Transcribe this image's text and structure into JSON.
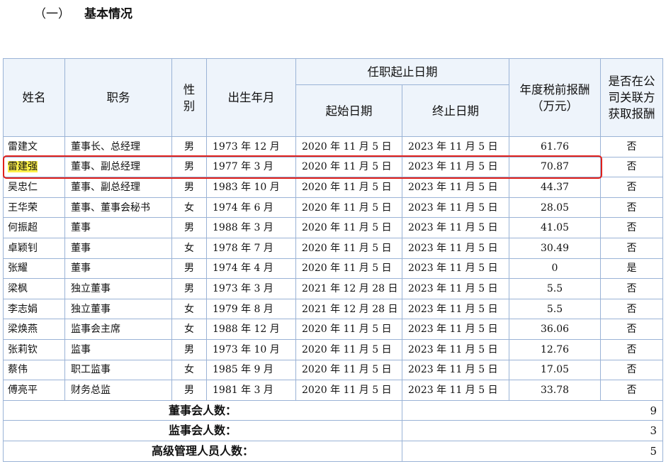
{
  "section": {
    "number": "（一）",
    "title": "基本情况"
  },
  "table": {
    "headers": {
      "name": "姓名",
      "position": "职务",
      "gender": "性别",
      "birth": "出生年月",
      "term": "任职起止日期",
      "start": "起始日期",
      "end": "终止日期",
      "salary": "年度税前报酬（万元）",
      "related": "是否在公司关联方获取报酬"
    },
    "rows": [
      {
        "name": "雷建文",
        "position": "董事长、总经理",
        "gender": "男",
        "birth": "1973 年 12 月",
        "start": "2020 年 11 月 5 日",
        "end": "2023 年 11 月 5 日",
        "salary": "61.76",
        "related": "否"
      },
      {
        "name": "雷建强",
        "position": "董事、副总经理",
        "gender": "男",
        "birth": "1977 年 3 月",
        "start": "2020 年 11 月 5 日",
        "end": "2023 年 11 月 5 日",
        "salary": "70.87",
        "related": "否"
      },
      {
        "name": "吴忠仁",
        "position": "董事、副总经理",
        "gender": "男",
        "birth": "1983 年 10 月",
        "start": "2020 年 11 月 5 日",
        "end": "2023 年 11 月 5 日",
        "salary": "44.37",
        "related": "否"
      },
      {
        "name": "王华荣",
        "position": "董事、董事会秘书",
        "gender": "女",
        "birth": "1974 年 6 月",
        "start": "2020 年 11 月 5 日",
        "end": "2023 年 11 月 5 日",
        "salary": "28.05",
        "related": "否"
      },
      {
        "name": "何振超",
        "position": "董事",
        "gender": "男",
        "birth": "1988 年 3 月",
        "start": "2020 年 11 月 5 日",
        "end": "2023 年 11 月 5 日",
        "salary": "41.05",
        "related": "否"
      },
      {
        "name": "卓颖钊",
        "position": "董事",
        "gender": "女",
        "birth": "1978 年 7 月",
        "start": "2020 年 11 月 5 日",
        "end": "2023 年 11 月 5 日",
        "salary": "30.49",
        "related": "否"
      },
      {
        "name": "张耀",
        "position": "董事",
        "gender": "男",
        "birth": "1974 年 4 月",
        "start": "2020 年 11 月 5 日",
        "end": "2023 年 11 月 5 日",
        "salary": "0",
        "related": "是"
      },
      {
        "name": "梁枫",
        "position": "独立董事",
        "gender": "男",
        "birth": "1973 年 3 月",
        "start": "2021 年 12 月 28 日",
        "end": "2023 年 11 月 5 日",
        "salary": "5.5",
        "related": "否"
      },
      {
        "name": "李志娟",
        "position": "独立董事",
        "gender": "女",
        "birth": "1979 年 8 月",
        "start": "2021 年 12 月 28 日",
        "end": "2023 年 11 月 5 日",
        "salary": "5.5",
        "related": "否"
      },
      {
        "name": "梁焕燕",
        "position": "监事会主席",
        "gender": "女",
        "birth": "1988 年 12 月",
        "start": "2020 年 11 月 5 日",
        "end": "2023 年 11 月 5 日",
        "salary": "36.06",
        "related": "否"
      },
      {
        "name": "张莉钦",
        "position": "监事",
        "gender": "男",
        "birth": "1973 年 10 月",
        "start": "2020 年 11 月 5 日",
        "end": "2023 年 11 月 5 日",
        "salary": "12.76",
        "related": "否"
      },
      {
        "name": "蔡伟",
        "position": "职工监事",
        "gender": "女",
        "birth": "1985 年 9 月",
        "start": "2020 年 11 月 5 日",
        "end": "2023 年 11 月 5 日",
        "salary": "17.05",
        "related": "否"
      },
      {
        "name": "傅亮平",
        "position": "财务总监",
        "gender": "男",
        "birth": "1981 年 3 月",
        "start": "2020 年 11 月 5 日",
        "end": "2023 年 11 月 5 日",
        "salary": "33.78",
        "related": "否"
      }
    ],
    "summary": [
      {
        "label": "董事会人数：",
        "value": "9"
      },
      {
        "label": "监事会人数：",
        "value": "3"
      },
      {
        "label": "高级管理人员人数：",
        "value": "5"
      }
    ]
  },
  "highlight": {
    "row_index": 1,
    "name_background": "#fff14a",
    "box_color": "#e0201b"
  }
}
